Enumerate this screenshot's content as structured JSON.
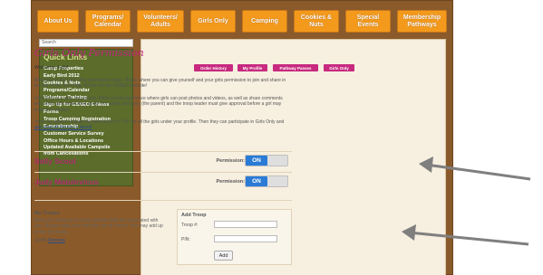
{
  "nav": [
    {
      "label": "About Us"
    },
    {
      "label": "Programs/\nCalendar"
    },
    {
      "label": "Volunteers/\nAdults"
    },
    {
      "label": "Girls Only"
    },
    {
      "label": "Camping"
    },
    {
      "label": "Cookies &\nNuts"
    },
    {
      "label": "Special\nEvents"
    },
    {
      "label": "Membership\nPathways"
    }
  ],
  "search": {
    "placeholder": "Search"
  },
  "quick_links": {
    "title": "Quick Links",
    "items": [
      "Camp Properties",
      "Early Bird 2012",
      "Cookies & Nuts",
      "Programs/Calendar",
      "Volunteer Training",
      "Sign Up for GSNEO E-News",
      "Forms",
      "Troop Camping Registration",
      "E-membership",
      "Customer Service Survey",
      "Office Hours & Locations",
      "Updated Available Campsite\nfrom Cancellations"
    ]
  },
  "main": {
    "title": "Girls Only Permission",
    "welcome": "Welcome Judy!",
    "buttons": [
      "Order History",
      "My Profile",
      "Pathway Passes",
      "Girls Only"
    ],
    "para1": "Welcome to the Girls Only permission page. This is where you can give yourself and your girls permission to join and share in the fun of the Girls Only section on the GSNEO website!",
    "para2": "Girls Only is a safe and secure online social experience where girls can post photos and videos, as well as share comments with other girls within their troop! For safety, both you (the parent) and the troop leader must give approval before a girl may enter this section.",
    "para3_pre": "To do so, please change the permission to \"On\" for all the girls under your profile. Then they can participate in Girls Only and ",
    "para3_link": "see what all the fun is about!",
    "users": [
      {
        "name": "Sally Scout",
        "permission_label": "Permission:",
        "state": "ON"
      },
      {
        "name": "Judy Matulevicus",
        "permission_label": "Permission:",
        "state": "ON"
      }
    ],
    "troops": {
      "title": "My Troops",
      "text": "Below is a listing of all troop numbers that are associated with you. Please make sure that they are all correct. You may add up to five (5) troops.",
      "number": "12345",
      "remove": "Remove"
    },
    "add_troop": {
      "title": "Add Troop",
      "troop_label": "Troop #:",
      "pin_label": "PIN:",
      "button": "Add"
    }
  }
}
